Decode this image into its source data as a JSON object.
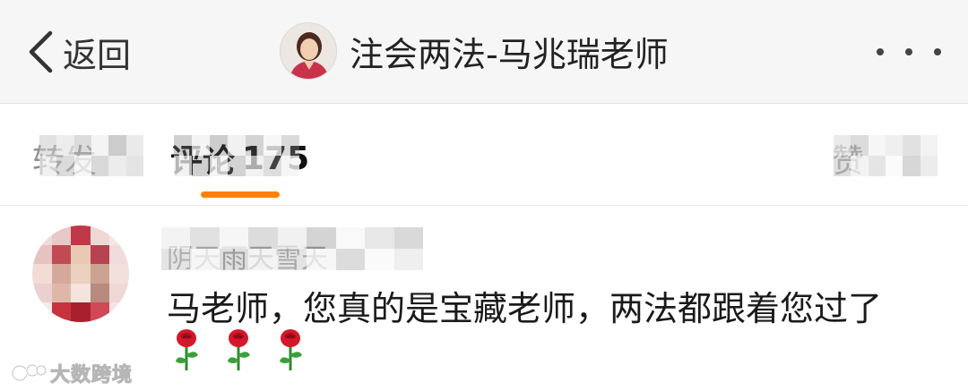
{
  "navbar": {
    "back_label": "返回",
    "title": "注会两法-马兆瑞老师",
    "avatar_icon": "profile-avatar",
    "more_icon": "more-dots-icon"
  },
  "tabs": {
    "forward_label": "转发",
    "forward_count": "",
    "comments_label": "评论",
    "comments_count": "175",
    "likes_label": "赞",
    "likes_count": "",
    "active": "comments",
    "accent_color": "#ff8200"
  },
  "comment": {
    "commenter_name": "阴天雨天雪天",
    "text": "马老师，您真的是宝藏老师，两法都跟着您过了",
    "emoji": [
      "rose",
      "rose",
      "rose"
    ]
  },
  "watermark": {
    "text": "大数跨境"
  }
}
